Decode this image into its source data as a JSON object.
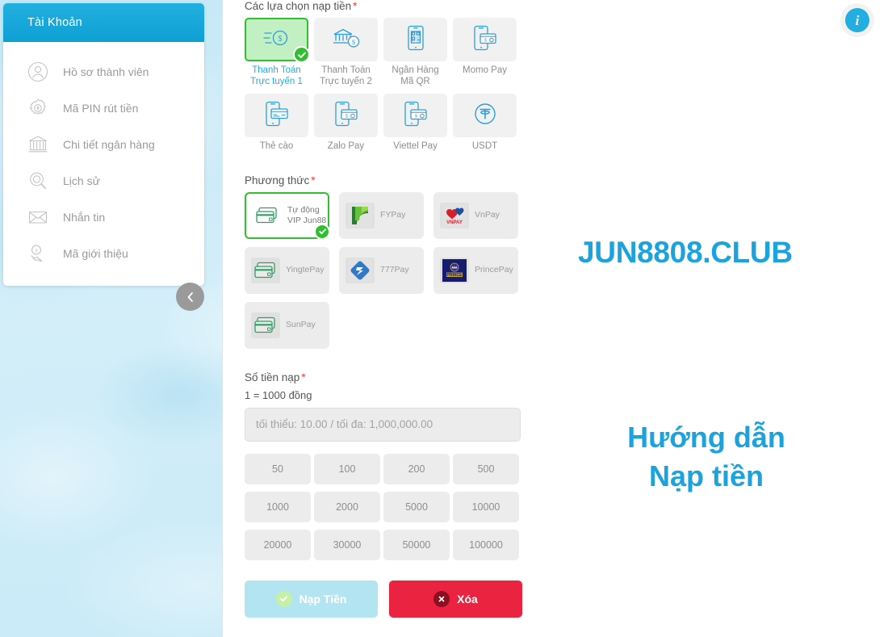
{
  "sidebar": {
    "title": "Tài Khoản",
    "items": [
      {
        "label": "Hồ sơ thành viên",
        "icon": "user-circle-icon"
      },
      {
        "label": "Mã PIN rút tiền",
        "icon": "gear-lock-icon"
      },
      {
        "label": "Chi tiết ngân hàng",
        "icon": "bank-icon"
      },
      {
        "label": "Lịch sử",
        "icon": "search-history-icon"
      },
      {
        "label": "Nhắn tin",
        "icon": "envelope-icon"
      },
      {
        "label": "Mã giới thiệu",
        "icon": "referral-handshake-icon"
      }
    ],
    "collapse_icon": "chevron-left-icon"
  },
  "info_button": {
    "icon": "info-icon",
    "label": "i"
  },
  "deposit_options": {
    "label": "Các lựa chọn nạp tiền",
    "required_mark": "*",
    "items": [
      {
        "label": "Thanh Toán\nTrực tuyến 1",
        "icon": "coin-fast-icon",
        "selected": true
      },
      {
        "label": "Thanh Toán\nTrực tuyến 2",
        "icon": "bank-coin-icon",
        "selected": false
      },
      {
        "label": "Ngân Hàng\nMã QR",
        "icon": "phone-qr-icon",
        "selected": false
      },
      {
        "label": "Momo Pay",
        "icon": "phone-wallet-icon",
        "selected": false
      },
      {
        "label": "Thẻ cào",
        "icon": "phone-card-icon",
        "selected": false
      },
      {
        "label": "Zalo Pay",
        "icon": "phone-wallet-icon",
        "selected": false
      },
      {
        "label": "Viettel Pay",
        "icon": "phone-wallet-icon",
        "selected": false
      },
      {
        "label": "USDT",
        "icon": "tether-icon",
        "selected": false
      }
    ]
  },
  "methods": {
    "label": "Phương thức",
    "required_mark": "*",
    "items": [
      {
        "name": "Tự động\nVIP Jun88",
        "logo": "credit-cards-icon",
        "selected": true
      },
      {
        "name": "FYPay",
        "logo": "fypay-logo",
        "selected": false
      },
      {
        "name": "VnPay",
        "logo": "vnpay-logo",
        "selected": false
      },
      {
        "name": "YingtePay",
        "logo": "credit-cards-icon",
        "selected": false
      },
      {
        "name": "777Pay",
        "logo": "777pay-logo",
        "selected": false
      },
      {
        "name": "PrincePay",
        "logo": "princepay-logo",
        "selected": false
      },
      {
        "name": "SunPay",
        "logo": "credit-cards-icon",
        "selected": false
      }
    ]
  },
  "amount": {
    "label": "Số tiền nạp",
    "required_mark": "*",
    "rate_hint": "1 = 1000 đồng",
    "input_value": "",
    "placeholder": "tối thiểu: 10.00 / tối đa: 1,000,000.00",
    "quick_values": [
      "50",
      "100",
      "200",
      "500",
      "1000",
      "2000",
      "5000",
      "10000",
      "20000",
      "30000",
      "50000",
      "100000"
    ]
  },
  "actions": {
    "deposit_label": "Nạp Tiền",
    "deposit_icon": "check-circle-icon",
    "clear_label": "Xóa",
    "clear_icon": "x-circle-icon"
  },
  "brand": {
    "title": "JUN8808.CLUB",
    "subtitle_line1": "Hướng dẫn",
    "subtitle_line2": "Nạp tiền"
  },
  "colors": {
    "accent_blue": "#1ba3dd",
    "header_blue": "#0e9fd3",
    "selected_green": "#2fbf2f",
    "danger_red": "#ea2340",
    "deposit_btn": "#b3e4f2",
    "page_bg": "#cdeaf6"
  }
}
